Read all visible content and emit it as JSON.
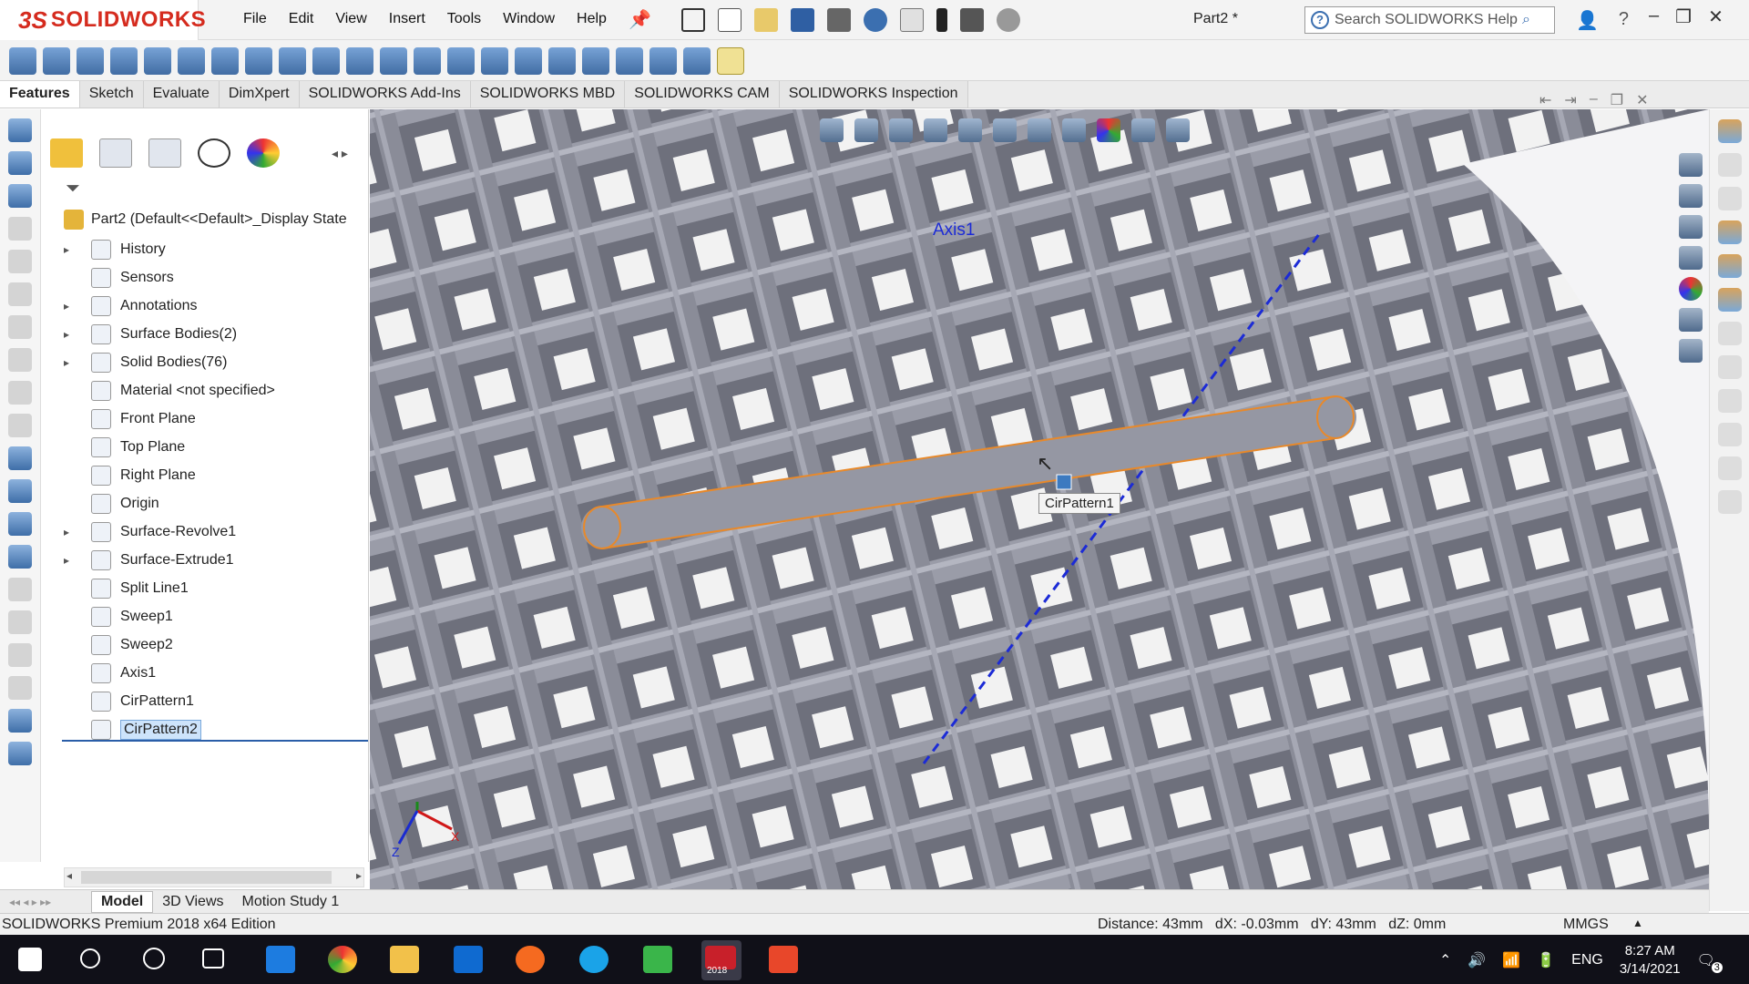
{
  "app": {
    "logo_ds": "3S",
    "logo_name": "SOLIDWORKS",
    "doc_title": "Part2 *"
  },
  "menu": [
    "File",
    "Edit",
    "View",
    "Insert",
    "Tools",
    "Window",
    "Help"
  ],
  "search": {
    "placeholder": "Search SOLIDWORKS Help"
  },
  "tabs": [
    "Features",
    "Sketch",
    "Evaluate",
    "DimXpert",
    "SOLIDWORKS Add-Ins",
    "SOLIDWORKS MBD",
    "SOLIDWORKS CAM",
    "SOLIDWORKS Inspection"
  ],
  "tree": {
    "root": "Part2  (Default<<Default>_Display State",
    "items": [
      {
        "label": "History",
        "expandable": true
      },
      {
        "label": "Sensors",
        "expandable": false
      },
      {
        "label": "Annotations",
        "expandable": true
      },
      {
        "label": "Surface Bodies(2)",
        "expandable": true
      },
      {
        "label": "Solid Bodies(76)",
        "expandable": true
      },
      {
        "label": "Material <not specified>",
        "expandable": false
      },
      {
        "label": "Front Plane",
        "expandable": false
      },
      {
        "label": "Top Plane",
        "expandable": false
      },
      {
        "label": "Right Plane",
        "expandable": false
      },
      {
        "label": "Origin",
        "expandable": false
      },
      {
        "label": "Surface-Revolve1",
        "expandable": true
      },
      {
        "label": "Surface-Extrude1",
        "expandable": true
      },
      {
        "label": "Split Line1",
        "expandable": false
      },
      {
        "label": "Sweep1",
        "expandable": false
      },
      {
        "label": "Sweep2",
        "expandable": false
      },
      {
        "label": "Axis1",
        "expandable": false
      },
      {
        "label": "CirPattern1",
        "expandable": false
      },
      {
        "label": "CirPattern2",
        "expandable": false,
        "selected": true
      }
    ]
  },
  "viewport": {
    "axis_label": "Axis1",
    "tooltip": "CirPattern1",
    "triad_y": "Y",
    "triad_x": "X",
    "triad_z": "Z"
  },
  "bottom_tabs": [
    "Model",
    "3D Views",
    "Motion Study 1"
  ],
  "status": {
    "edition": "SOLIDWORKS Premium 2018 x64 Edition",
    "measure": "Distance: 43mm   dX: -0.03mm   dY: 43mm   dZ: 0mm",
    "units": "MMGS"
  },
  "taskbar": {
    "lang": "ENG",
    "time": "8:27 AM",
    "date": "3/14/2021",
    "notifications": "3",
    "sw_badge": "2018"
  },
  "colors": {
    "accent": "#d52b1e",
    "selection": "#e8892a",
    "axis": "#1c2bd6",
    "mesh": "#8c8e9b"
  }
}
